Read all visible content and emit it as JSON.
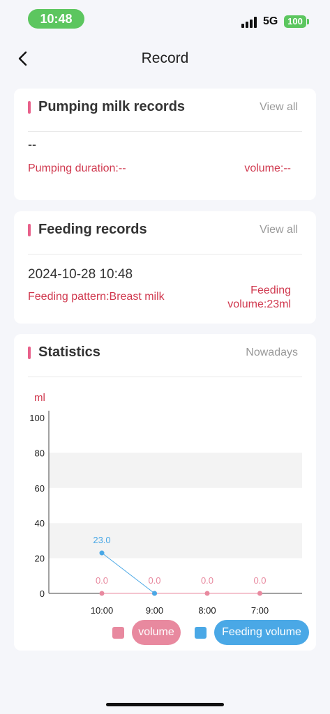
{
  "status": {
    "time": "10:48",
    "network": "5G",
    "battery": "100"
  },
  "nav": {
    "title": "Record"
  },
  "pumping": {
    "title": "Pumping milk records",
    "link": "View all",
    "value": "--",
    "duration": "Pumping duration:--",
    "volume": "volume:--"
  },
  "feeding": {
    "title": "Feeding records",
    "link": "View all",
    "date": "2024-10-28 10:48",
    "pattern": "Feeding pattern:Breast milk",
    "volume_line1": "Feeding",
    "volume_line2": "volume:23ml"
  },
  "statistics": {
    "title": "Statistics",
    "period": "Nowadays"
  },
  "chart_data": {
    "type": "line",
    "ylabel": "ml",
    "ylim": [
      0,
      100
    ],
    "yticks": [
      0,
      20,
      40,
      60,
      80,
      100
    ],
    "categories": [
      "10:00",
      "9:00",
      "8:00",
      "7:00"
    ],
    "series": [
      {
        "name": "volume",
        "color": "#e8899f",
        "values": [
          0,
          0,
          0,
          0
        ],
        "labels": [
          "0.0",
          "0.0",
          "0.0",
          "0.0"
        ]
      },
      {
        "name": "Feeding volume",
        "color": "#4aa8e6",
        "values": [
          23,
          0
        ],
        "labels": [
          "23.0"
        ]
      }
    ]
  },
  "legend": {
    "volume": "volume",
    "feeding_volume": "Feeding volume",
    "volume_color": "#e8899f",
    "feeding_color": "#4aa8e6"
  }
}
